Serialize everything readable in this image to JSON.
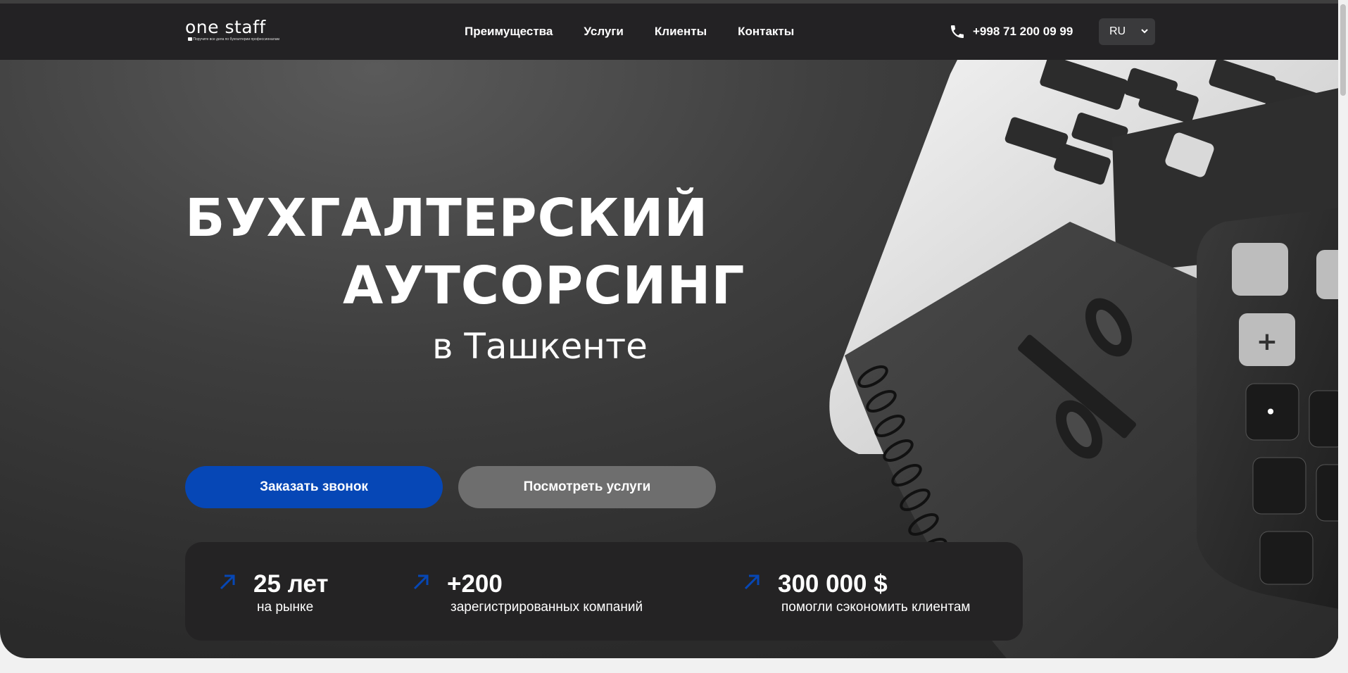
{
  "logo": {
    "name": "one staff",
    "tagline": "Поручите все дела по бухгалтерии профессионалам"
  },
  "nav": {
    "items": [
      "Преимущества",
      "Услуги",
      "Клиенты",
      "Контакты"
    ]
  },
  "phone": "+998 71 200 09 99",
  "language": "RU",
  "hero": {
    "title_line1": "БУХГАЛТЕРСКИЙ",
    "title_line2": "АУТСОРСИНГ",
    "subtitle": "в Ташкенте"
  },
  "buttons": {
    "primary": "Заказать звонок",
    "secondary": "Посмотреть услуги"
  },
  "stats": [
    {
      "value": "25 лет",
      "label": "на рынке"
    },
    {
      "value": "+200",
      "label": "зарегистрированных компаний"
    },
    {
      "value": "300 000 $",
      "label": "помогли сэкономить клиентам"
    }
  ],
  "colors": {
    "accent": "#0647b6",
    "navbar": "#232224",
    "secondary_button": "#6e6e6e"
  },
  "icons": {
    "phone": "phone-icon",
    "stat_arrow": "arrow-up-right-icon",
    "lang_dropdown": "chevron-down-icon"
  }
}
